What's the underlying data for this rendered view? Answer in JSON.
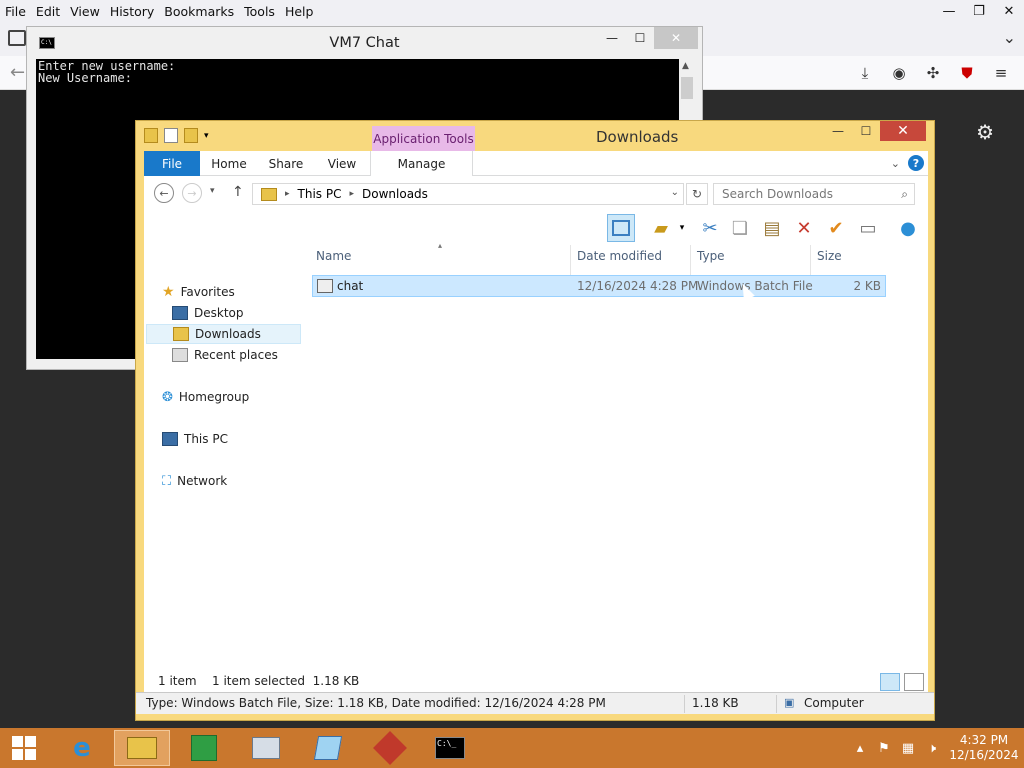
{
  "browser": {
    "menu": [
      "File",
      "Edit",
      "View",
      "History",
      "Bookmarks",
      "Tools",
      "Help"
    ],
    "menu_underline": [
      "F",
      "E",
      "V",
      "H",
      "B",
      "T",
      "H"
    ]
  },
  "console": {
    "title": "VM7 Chat",
    "lines": [
      "Enter new username:",
      "New Username:"
    ]
  },
  "explorer": {
    "title": "Downloads",
    "app_tools": "Application Tools",
    "tabs": [
      "File",
      "Home",
      "Share",
      "View",
      "Manage"
    ],
    "breadcrumb": [
      "This PC",
      "Downloads"
    ],
    "search_placeholder": "Search Downloads",
    "nav": {
      "favorites": "Favorites",
      "desktop": "Desktop",
      "downloads": "Downloads",
      "recent": "Recent places",
      "homegroup": "Homegroup",
      "thispc": "This PC",
      "network": "Network"
    },
    "columns": [
      "Name",
      "Date modified",
      "Type",
      "Size"
    ],
    "files": [
      {
        "name": "chat",
        "date": "12/16/2024 4:28 PM",
        "type": "Windows Batch File",
        "size": "2 KB"
      }
    ],
    "status": {
      "count": "1 item",
      "selected": "1 item selected  1.18 KB"
    },
    "details": {
      "info": "Type: Windows Batch File, Size: 1.18 KB, Date modified: 12/16/2024 4:28 PM",
      "size": "1.18 KB",
      "location": "Computer"
    }
  },
  "taskbar": {
    "time": "4:32 PM",
    "date": "12/16/2024"
  },
  "colors": {
    "taskbar": "#c9772d",
    "explorer_frame": "#f8d97e",
    "file_tab": "#1979ca",
    "selection": "#cce8ff",
    "close_button": "#c7483b"
  }
}
